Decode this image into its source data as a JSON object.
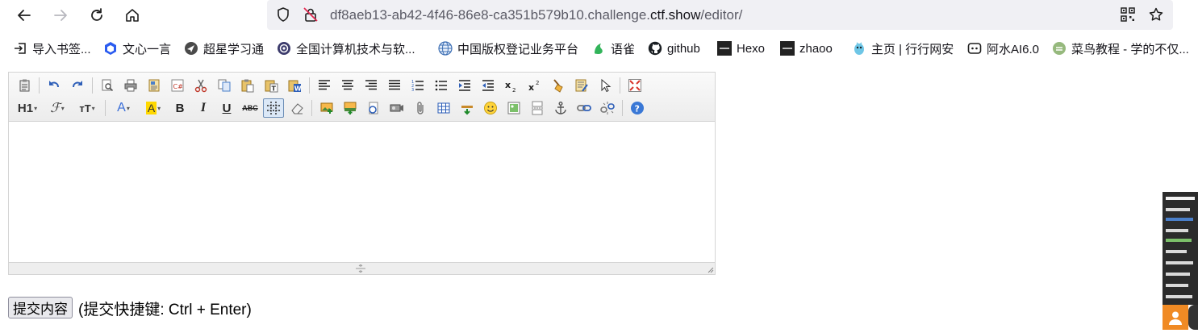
{
  "browser": {
    "url_host_prefix": "df8aeb13-ab42-4f46-86e8-ca351b579b10.challenge.",
    "url_host_domain": "ctf.show",
    "url_path": "/editor/"
  },
  "bookmarks": [
    {
      "label": "导入书签...",
      "icon": "import-icon"
    },
    {
      "label": "文心一言",
      "icon": "wenxin-icon"
    },
    {
      "label": "超星学习通",
      "icon": "chaoxing-icon"
    },
    {
      "label": "全国计算机技术与软...",
      "icon": "ruankao-icon"
    },
    {
      "label": "中国版权登记业务平台",
      "icon": "copyright-icon"
    },
    {
      "label": "语雀",
      "icon": "yuque-icon"
    },
    {
      "label": "github",
      "icon": "github-icon"
    },
    {
      "label": "Hexo",
      "icon": "hexo-icon"
    },
    {
      "label": "zhaoo",
      "icon": "zhaoo-icon"
    },
    {
      "label": "主页 | 行行网安",
      "icon": "hanghang-icon"
    },
    {
      "label": "阿水AI6.0",
      "icon": "ashui-icon"
    },
    {
      "label": "菜鸟教程 - 学的不仅...",
      "icon": "runoob-icon"
    }
  ],
  "toolbar": {
    "heading_label": "H1",
    "font_label": "ℱ",
    "size_label": "тT",
    "text_color_label": "A",
    "bold_label": "B",
    "italic_label": "I",
    "underline_label": "U",
    "strike_label": "ABC",
    "colors": {
      "text_color": "#3b6fd8",
      "highlight": "#ffd800"
    }
  },
  "form": {
    "submit_label": "提交内容",
    "hint_text": "(提交快捷键: Ctrl + Enter)"
  }
}
